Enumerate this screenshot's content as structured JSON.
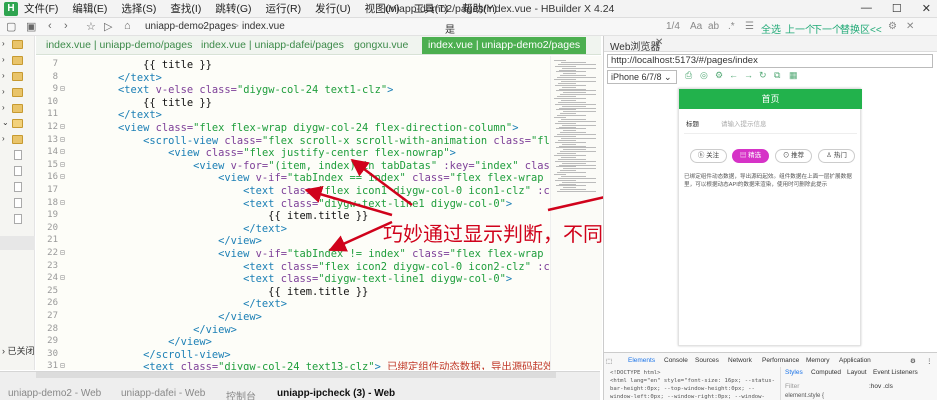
{
  "menu": {
    "items": [
      "文件(F)",
      "编辑(E)",
      "选择(S)",
      "查找(I)",
      "跳转(G)",
      "运行(R)",
      "发行(U)",
      "视图(V)",
      "工具(T)",
      "帮助(Y)"
    ],
    "window_title": "uniapp-demo2/pages/index.vue - HBuilder X 4.24"
  },
  "toolbar": {
    "breadcrumb": [
      "uniapp-demo2",
      "pages",
      "index.vue"
    ],
    "find_text": "是",
    "find_count": "1/4",
    "find_options": [
      "全选",
      "上一个",
      "下一个",
      "替换区<<"
    ]
  },
  "tabs": [
    {
      "label": "index.vue | uniapp-demo/pages",
      "active": false
    },
    {
      "label": "index.vue | uniapp-dafei/pages",
      "active": false
    },
    {
      "label": "gongxu.vue",
      "active": false
    },
    {
      "label": "index.vue | uniapp-demo2/pages",
      "active": true
    }
  ],
  "sidebar": {
    "bottom_label": "已关闭"
  },
  "code": {
    "lines": [
      {
        "n": "7",
        "fold": "",
        "segs": [
          [
            "tx",
            "            {{ title }}"
          ]
        ]
      },
      {
        "n": "8",
        "fold": "",
        "segs": [
          [
            "tg",
            "        </text>"
          ]
        ]
      },
      {
        "n": "9",
        "fold": "⊟",
        "segs": [
          [
            "tg",
            "        <text "
          ],
          [
            "at",
            "v-else "
          ],
          [
            "at",
            "class="
          ],
          [
            "st",
            "\"diygw-col-24 text1-clz\""
          ],
          [
            "tg",
            ">"
          ]
        ]
      },
      {
        "n": "10",
        "fold": "",
        "segs": [
          [
            "tx",
            "            {{ title }}"
          ]
        ]
      },
      {
        "n": "11",
        "fold": "",
        "segs": [
          [
            "tg",
            "        </text>"
          ]
        ]
      },
      {
        "n": "12",
        "fold": "⊟",
        "segs": [
          [
            "tg",
            "        <view "
          ],
          [
            "at",
            "class="
          ],
          [
            "st",
            "\"flex flex-wrap diygw-col-24 flex-direction-column\""
          ],
          [
            "tg",
            ">"
          ]
        ]
      },
      {
        "n": "13",
        "fold": "⊟",
        "segs": [
          [
            "tg",
            "            <scroll-view "
          ],
          [
            "at",
            "class="
          ],
          [
            "st",
            "\"flex scroll-x scroll-with-animation "
          ],
          [
            "at",
            "class="
          ],
          [
            "st",
            "\"flex scroll-view flex-wrap d"
          ]
        ]
      },
      {
        "n": "14",
        "fold": "⊟",
        "segs": [
          [
            "tg",
            "                <view "
          ],
          [
            "at",
            "class="
          ],
          [
            "st",
            "\"flex justify-center flex-nowrap\""
          ],
          [
            "tg",
            ">"
          ]
        ]
      },
      {
        "n": "15",
        "fold": "⊟",
        "segs": [
          [
            "tg",
            "                    <view "
          ],
          [
            "at",
            "v-for="
          ],
          [
            "st",
            "\"(item, index) in tabDatas\" "
          ],
          [
            "at",
            ":key="
          ],
          [
            "st",
            "\"index\" "
          ],
          [
            "at",
            "class="
          ],
          [
            "st",
            "\"flex flex-w"
          ]
        ]
      },
      {
        "n": "16",
        "fold": "⊟",
        "segs": [
          [
            "tg",
            "                        <view "
          ],
          [
            "at",
            "v-if="
          ],
          [
            "st",
            "\"tabIndex == index\" "
          ],
          [
            "at",
            "class="
          ],
          [
            "st",
            "\"flex flex-wrap diygw-col-24 i"
          ]
        ]
      },
      {
        "n": "17",
        "fold": "",
        "segs": [
          [
            "tg",
            "                            <text "
          ],
          [
            "at",
            "class="
          ],
          [
            "st",
            "\"flex icon1 diygw-col-0 icon1-clz\" "
          ],
          [
            "at",
            ":class="
          ],
          [
            "st",
            "\"[item.ic"
          ]
        ]
      },
      {
        "n": "18",
        "fold": "⊟",
        "segs": [
          [
            "tg",
            "                            <text "
          ],
          [
            "at",
            "class="
          ],
          [
            "st",
            "\"diygw-text-line1 diygw-col-0\""
          ],
          [
            "tg",
            ">"
          ]
        ]
      },
      {
        "n": "19",
        "fold": "",
        "segs": [
          [
            "tx",
            "                                {{ item.title }}"
          ]
        ]
      },
      {
        "n": "20",
        "fold": "",
        "segs": [
          [
            "tg",
            "                            </text>"
          ]
        ]
      },
      {
        "n": "21",
        "fold": "",
        "segs": [
          [
            "tg",
            "                        </view>"
          ]
        ]
      },
      {
        "n": "22",
        "fold": "⊟",
        "segs": [
          [
            "tg",
            "                        <view "
          ],
          [
            "at",
            "v-if="
          ],
          [
            "st",
            "\"tabIndex != index\" "
          ],
          [
            "at",
            "class="
          ],
          [
            "st",
            "\"flex flex-wrap diygw-col-24 i"
          ]
        ]
      },
      {
        "n": "23",
        "fold": "",
        "segs": [
          [
            "tg",
            "                            <text "
          ],
          [
            "at",
            "class="
          ],
          [
            "st",
            "\"flex icon2 diygw-col-0 icon2-clz\" "
          ],
          [
            "at",
            ":class="
          ],
          [
            "st",
            "\"[item.ic"
          ]
        ]
      },
      {
        "n": "24",
        "fold": "⊟",
        "segs": [
          [
            "tg",
            "                            <text "
          ],
          [
            "at",
            "class="
          ],
          [
            "st",
            "\"diygw-text-line1 diygw-col-0\""
          ],
          [
            "tg",
            ">"
          ]
        ]
      },
      {
        "n": "25",
        "fold": "",
        "segs": [
          [
            "tx",
            "                                {{ item.title }}"
          ]
        ]
      },
      {
        "n": "26",
        "fold": "",
        "segs": [
          [
            "tg",
            "                            </text>"
          ]
        ]
      },
      {
        "n": "27",
        "fold": "",
        "segs": [
          [
            "tg",
            "                        </view>"
          ]
        ]
      },
      {
        "n": "28",
        "fold": "",
        "segs": [
          [
            "tg",
            "                    </view>"
          ]
        ]
      },
      {
        "n": "29",
        "fold": "",
        "segs": [
          [
            "tg",
            "                </view>"
          ]
        ]
      },
      {
        "n": "30",
        "fold": "",
        "segs": [
          [
            "tg",
            "            </scroll-view>"
          ]
        ]
      },
      {
        "n": "31",
        "fold": "⊟",
        "segs": [
          [
            "tg",
            "            <text "
          ],
          [
            "at",
            "class="
          ],
          [
            "st",
            "\"diygw-col-24 text13-clz\""
          ],
          [
            "tg",
            "> "
          ],
          [
            "cn",
            "已绑定组件动态数据，导出源码起效。组件数据在"
          ]
        ]
      }
    ]
  },
  "annotation": "巧妙通过显示判断，不同选中状态时显示不同效果。",
  "bottom_tabs": [
    {
      "label": "uniapp-demo2 - Web",
      "state": "dim"
    },
    {
      "label": "uniapp-dafei - Web",
      "state": "dim"
    },
    {
      "label": "控制台",
      "state": "dim"
    },
    {
      "label": "uniapp-ipcheck (3) - Web",
      "state": "cur"
    }
  ],
  "browser": {
    "title": "Web浏览器",
    "url": "http://localhost:5173/#/pages/index",
    "device": "iPhone 6/7/8",
    "phone": {
      "header": "首页",
      "label": "标题",
      "input_placeholder": "请输入提示信息",
      "pills": [
        {
          "label": "关注",
          "icon": "ⓗ",
          "active": false
        },
        {
          "label": "精选",
          "icon": "▤",
          "active": true
        },
        {
          "label": "推荐",
          "icon": "⊙",
          "active": false
        },
        {
          "label": "热门",
          "icon": "♙",
          "active": false
        }
      ],
      "description": "已绑定组件动态数据，导出源码起效。组件数据在上面一层扩展数据里，可以根据动态API的数据来渲染，使用时可删除此提示"
    }
  },
  "devtools": {
    "tabs": [
      "Elements",
      "Console",
      "Sources",
      "Network",
      "Performance",
      "Memory",
      "Application"
    ],
    "active_tab": "Elements",
    "source_lines": [
      "<!DOCTYPE html>",
      "<html lang=\"en\" style=\"font-size: 16px; --status-bar-height:0px; --top-window-height:0px; --window-left:0px; --window-right:0px; --window-margin:0px; --"
    ],
    "style_tabs": [
      "Styles",
      "Computed",
      "Layout",
      "Event Listeners"
    ],
    "filter_placeholder": "Filter",
    "hov_cls": ":hov .cls",
    "element_style": "element.style {"
  },
  "colors": {
    "accent_green": "#4caf50",
    "phone_header": "#22b24c",
    "active_pill": "#d633c7",
    "annotation_red": "#d0021b"
  }
}
